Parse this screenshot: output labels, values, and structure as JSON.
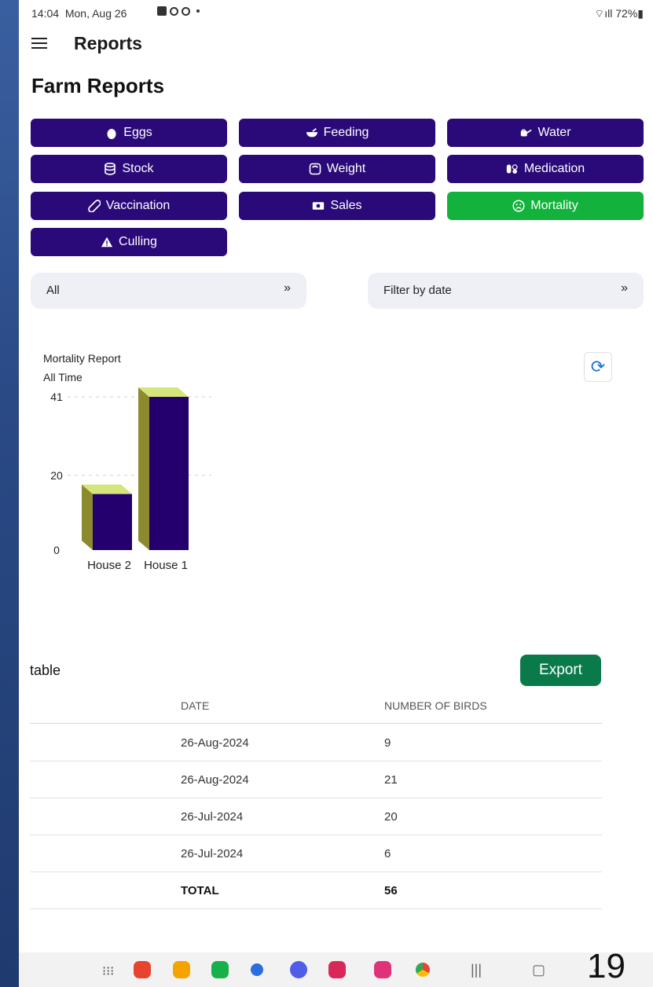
{
  "status": {
    "time": "14:04",
    "date": "Mon, Aug 26",
    "battery": "72%"
  },
  "appbar": {
    "title": "Reports"
  },
  "page": {
    "title": "Farm Reports"
  },
  "categories": [
    {
      "label": "Eggs",
      "icon": "egg-icon"
    },
    {
      "label": "Feeding",
      "icon": "bowl-icon"
    },
    {
      "label": "Water",
      "icon": "watering-can-icon"
    },
    {
      "label": "Stock",
      "icon": "database-icon"
    },
    {
      "label": "Weight",
      "icon": "scale-icon"
    },
    {
      "label": "Medication",
      "icon": "pills-icon"
    },
    {
      "label": "Vaccination",
      "icon": "capsule-icon"
    },
    {
      "label": "Sales",
      "icon": "cash-icon"
    },
    {
      "label": "Mortality",
      "icon": "sad-face-icon",
      "active": true
    },
    {
      "label": "Culling",
      "icon": "warning-icon"
    }
  ],
  "filters": {
    "house": "All",
    "date": "Filter by date"
  },
  "chart_data": {
    "type": "bar",
    "title": "Mortality Report",
    "subtitle": "All Time",
    "categories": [
      "House 2",
      "House 1"
    ],
    "values": [
      15,
      41
    ],
    "yticks": [
      0,
      20,
      41
    ],
    "ylim": [
      0,
      41
    ],
    "grid": true,
    "colors": {
      "front": "#23006e",
      "top": "#d4e67a",
      "side": "#8b8a2e"
    }
  },
  "table": {
    "title": "table",
    "export_label": "Export",
    "columns": [
      "DATE",
      "NUMBER OF BIRDS"
    ],
    "rows": [
      [
        "26-Aug-2024",
        "9"
      ],
      [
        "26-Aug-2024",
        "21"
      ],
      [
        "26-Jul-2024",
        "20"
      ],
      [
        "26-Jul-2024",
        "6"
      ]
    ],
    "total_label": "TOTAL",
    "total_value": "56"
  },
  "page_number": "19",
  "colors": {
    "primary": "#2a0a78",
    "active": "#12b23c",
    "export": "#0b7a4b"
  }
}
